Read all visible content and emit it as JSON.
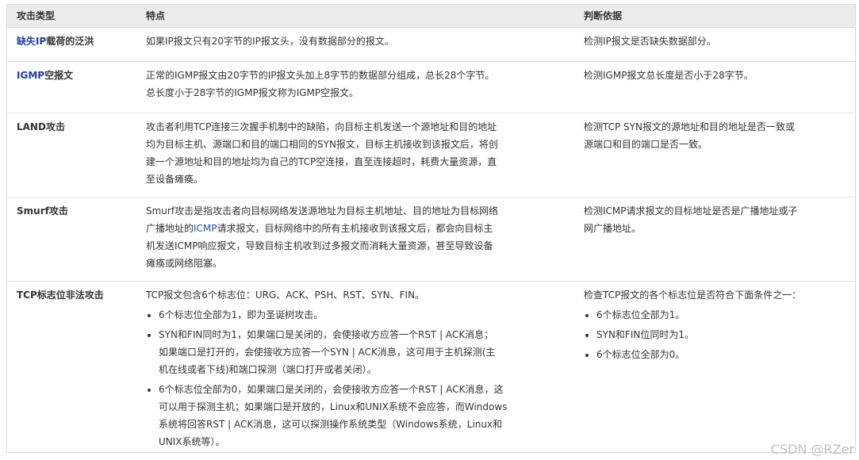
{
  "headers": [
    "攻击类型",
    "特点",
    "判断依据"
  ],
  "rows": [
    {
      "type_hl": "缺失IP",
      "type_rest": "载荷的泛洪",
      "feature": [
        "如果IP报文只有20字节的IP报文头，没有数据部分的报文。"
      ],
      "basis": [
        "检测IP报文是否缺失数据部分。"
      ]
    },
    {
      "type_hl": "IGMP",
      "type_rest": "空报文",
      "feature": [
        "正常的IGMP报文由20字节的IP报文头加上8字节的数据部分组成，总长28个字节。",
        "总长度小于28字节的IGMP报文称为IGMP空报文。"
      ],
      "basis": [
        "检测IGMP报文总长度是否小于28字节。"
      ]
    },
    {
      "type_hl": "",
      "type_rest": "LAND攻击",
      "feature": [
        "攻击者利用TCP连接三次握手机制中的缺陷，向目标主机发送一个源地址和目的地址",
        "均为目标主机、源端口和目的端口相同的SYN报文，目标主机接收到该报文后，将创",
        "建一个源地址和目的地址均为自己的TCP空连接，直至连接超时，耗费大量资源，直",
        "至设备瘫痪。"
      ],
      "basis": [
        "检测TCP SYN报文的源地址和目的地址是否一致或",
        "源端口和目的端口是否一致。"
      ]
    },
    {
      "type_hl": "",
      "type_rest": "Smurf攻击",
      "feature_l1": "Smurf攻击是指攻击者向目标网络发送源地址为目标主机地址、目的地址为目标网络",
      "feature_l2a": "广播地址的",
      "feature_l2link": "ICMP",
      "feature_l2b": "请求报文，目标网络中的所有主机接收到该报文后，都会向目标主",
      "feature_l3": "机发送ICMP响应报文，导致目标主机收到过多报文而消耗大量资源，甚至导致设备",
      "feature_l4": "瘫痪或网络阻塞。",
      "basis": [
        "检测ICMP请求报文的目标地址是否是广播地址或子",
        "网广播地址。"
      ]
    },
    {
      "type_hl": "",
      "type_rest": "TCP标志位非法攻击",
      "feature_intro": "TCP报文包含6个标志位：URG、ACK、PSH、RST、SYN、FIN。",
      "feature_items": [
        [
          "6个标志位全部为1，即为圣诞树攻击。"
        ],
        [
          "SYN和FIN同时为1，如果端口是关闭的，会使接收方应答一个RST | ACK消息；",
          "如果端口是打开的，会使接收方应答一个SYN | ACK消息，这可用于主机探测(主",
          "机在线或者下线)和端口探测（端口打开或者关闭）。"
        ],
        [
          "6个标志位全部为0，如果端口是关闭的，会使接收方应答一个RST | ACK消息，这",
          "可以用于探测主机；如果端口是开放的，Linux和UNIX系统不会应答，而Windows",
          "系统将回答RST | ACK消息，这可以探测操作系统类型（Windows系统，Linux和",
          "UNIX系统等）。"
        ]
      ],
      "basis_intro": "检查TCP报文的各个标志位是否符合下面条件之一：",
      "basis_items": [
        "6个标志位全部为1。",
        "SYN和FIN位同时为1。",
        "6个标志位全部为0。"
      ]
    }
  ],
  "watermark": "CSDN @RZer"
}
